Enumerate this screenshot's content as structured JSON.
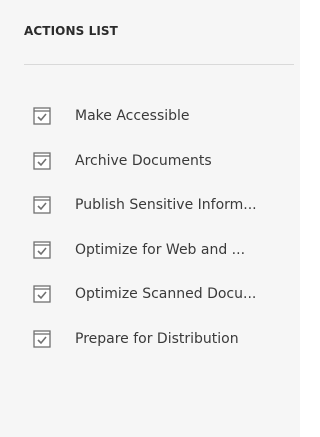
{
  "panel": {
    "header": "ACTIONS LIST"
  },
  "actions": [
    {
      "label": "Make Accessible",
      "icon": "action-checklist-icon"
    },
    {
      "label": "Archive Documents",
      "icon": "action-checklist-icon"
    },
    {
      "label": "Publish Sensitive Inform...",
      "icon": "action-checklist-icon"
    },
    {
      "label": "Optimize for Web and ...",
      "icon": "action-checklist-icon"
    },
    {
      "label": "Optimize Scanned Docu...",
      "icon": "action-checklist-icon"
    },
    {
      "label": "Prepare for Distribution",
      "icon": "action-checklist-icon"
    }
  ],
  "colors": {
    "panel_background": "#f6f6f6",
    "text": "#3a3a3a",
    "icon": "#707070"
  }
}
